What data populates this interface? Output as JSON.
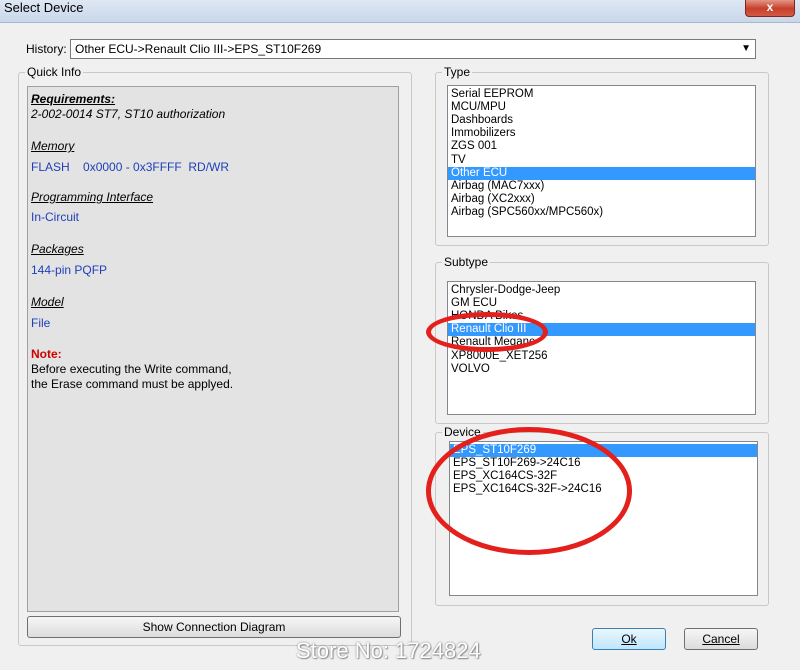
{
  "window": {
    "title": "Select Device",
    "close_label": "x"
  },
  "history": {
    "label": "History:",
    "value": "Other ECU->Renault Clio III->EPS_ST10F269",
    "arrow": "▼"
  },
  "quick_info": {
    "legend": "Quick Info",
    "requirements_heading": "Requirements:",
    "requirements_text": "2-002-0014  ST7, ST10 authorization",
    "memory_heading": "Memory",
    "memory_text": "FLASH    0x0000 - 0x3FFFF  RD/WR",
    "interface_heading": "Programming Interface",
    "interface_text": "In-Circuit",
    "packages_heading": "Packages",
    "packages_text": "144-pin PQFP",
    "model_heading": "Model",
    "model_text": "File",
    "note_heading": "Note:",
    "note_line1": "Before executing the Write command,",
    "note_line2": "the Erase command must be applyed."
  },
  "buttons": {
    "show_diagram": "Show Connection Diagram",
    "ok": "Ok",
    "cancel": "Cancel"
  },
  "type": {
    "legend": "Type",
    "items": [
      "Serial EEPROM",
      "MCU/MPU",
      "Dashboards",
      "Immobilizers",
      "ZGS 001",
      "TV",
      "Other ECU",
      "Airbag (MAC7xxx)",
      "Airbag (XC2xxx)",
      "Airbag (SPC560xx/MPC560x)"
    ],
    "selected_index": 6
  },
  "subtype": {
    "legend": "Subtype",
    "items": [
      "Chrysler-Dodge-Jeep",
      "GM ECU",
      "HONDA Bikes",
      "Renault Clio III",
      "Renault Megane",
      "XP8000E_XET256",
      "VOLVO"
    ],
    "selected_index": 3
  },
  "device": {
    "legend": "Device",
    "items": [
      "EPS_ST10F269",
      "EPS_ST10F269->24C16",
      "EPS_XC164CS-32F",
      "EPS_XC164CS-32F->24C16"
    ],
    "selected_index": 0
  },
  "annotation_color": "#e3201b",
  "selection_color": "#3399ff",
  "watermark": "Store No: 1724824"
}
